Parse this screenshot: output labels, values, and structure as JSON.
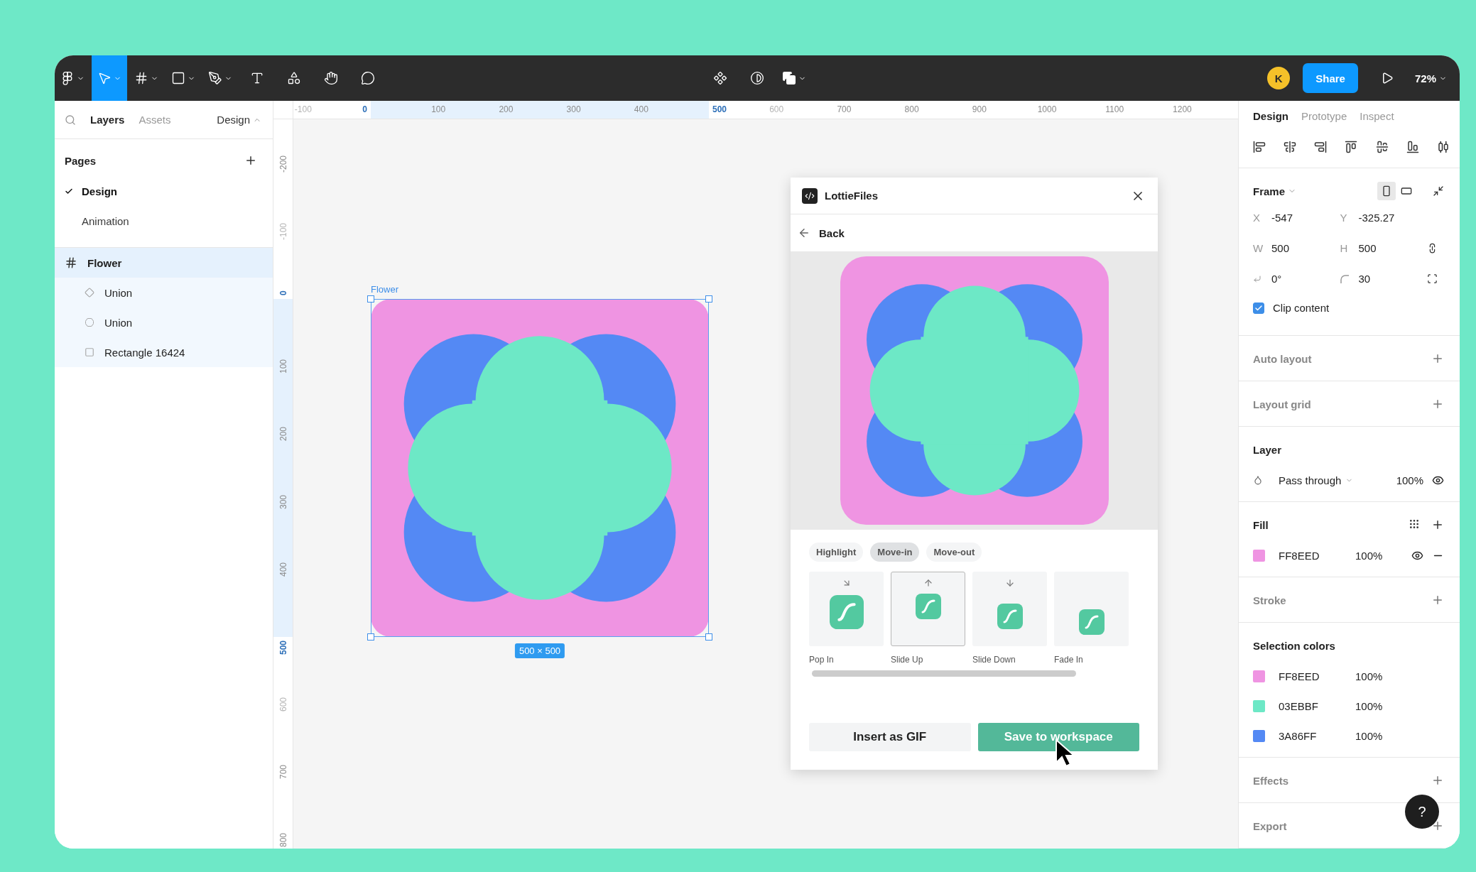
{
  "toolbar": {
    "tools": [
      {
        "kind": "logo",
        "selected": false,
        "caret": true
      },
      {
        "kind": "move",
        "selected": true,
        "caret": true
      },
      {
        "kind": "frame",
        "selected": false,
        "caret": true
      },
      {
        "kind": "rectangle",
        "selected": false,
        "caret": true
      },
      {
        "kind": "pen",
        "selected": false,
        "caret": true
      },
      {
        "kind": "text",
        "selected": false,
        "caret": false
      },
      {
        "kind": "components",
        "selected": false,
        "caret": false
      },
      {
        "kind": "hand",
        "selected": false,
        "caret": false
      },
      {
        "kind": "comment",
        "selected": false,
        "caret": false
      }
    ],
    "center_tools": [
      {
        "kind": "component",
        "caret": false
      },
      {
        "kind": "contrast",
        "caret": false
      },
      {
        "kind": "boolean",
        "caret": true
      }
    ],
    "avatar": "K",
    "share": "Share",
    "zoom": "72%"
  },
  "left_panel": {
    "tabs": [
      {
        "label": "Layers",
        "selected": true
      },
      {
        "label": "Assets",
        "selected": false
      }
    ],
    "page_menu": "Design",
    "pages_title": "Pages",
    "pages": [
      {
        "label": "Design",
        "selected": true
      },
      {
        "label": "Animation",
        "selected": false
      }
    ],
    "layers": [
      {
        "name": "Flower",
        "kind": "frame",
        "selected": true,
        "children": [
          {
            "name": "Union",
            "kind": "diamond",
            "selected": false
          },
          {
            "name": "Union",
            "kind": "clover",
            "selected": false
          },
          {
            "name": "Rectangle 16424",
            "kind": "rectangle",
            "selected": false
          }
        ]
      }
    ]
  },
  "rulers": {
    "horizontal": [
      {
        "label": "-100",
        "kind": "faded"
      },
      {
        "label": "0",
        "kind": "start"
      },
      {
        "label": "100",
        "kind": "normal"
      },
      {
        "label": "200",
        "kind": "normal"
      },
      {
        "label": "300",
        "kind": "normal"
      },
      {
        "label": "400",
        "kind": "normal"
      },
      {
        "label": "500",
        "kind": "end"
      },
      {
        "label": "600",
        "kind": "faded"
      },
      {
        "label": "700",
        "kind": "normal"
      },
      {
        "label": "800",
        "kind": "normal"
      },
      {
        "label": "900",
        "kind": "normal"
      },
      {
        "label": "1000",
        "kind": "normal"
      },
      {
        "label": "1100",
        "kind": "normal"
      },
      {
        "label": "1200",
        "kind": "normal"
      }
    ],
    "vertical": [
      {
        "label": "-200",
        "kind": "normal"
      },
      {
        "label": "-100",
        "kind": "faded"
      },
      {
        "label": "0",
        "kind": "start"
      },
      {
        "label": "100",
        "kind": "normal"
      },
      {
        "label": "200",
        "kind": "normal"
      },
      {
        "label": "300",
        "kind": "normal"
      },
      {
        "label": "400",
        "kind": "normal"
      },
      {
        "label": "500",
        "kind": "end"
      },
      {
        "label": "600",
        "kind": "faded"
      },
      {
        "label": "700",
        "kind": "normal"
      },
      {
        "label": "800",
        "kind": "normal"
      }
    ]
  },
  "canvas": {
    "frame_label": "Flower",
    "size_badge": "500 × 500"
  },
  "plugin": {
    "title": "LottieFiles",
    "back": "Back",
    "tabs": [
      {
        "label": "Highlight",
        "selected": false
      },
      {
        "label": "Move-in",
        "selected": true
      },
      {
        "label": "Move-out",
        "selected": false
      }
    ],
    "animations": [
      {
        "label": "Pop In",
        "kind": "pop",
        "selected": false
      },
      {
        "label": "Slide Up",
        "kind": "slide-up",
        "selected": true
      },
      {
        "label": "Slide Down",
        "kind": "slide-down",
        "selected": false
      },
      {
        "label": "Fade In",
        "kind": "fade",
        "selected": false
      }
    ],
    "buttons": [
      {
        "label": "Insert as GIF",
        "kind": "secondary"
      },
      {
        "label": "Save to workspace",
        "kind": "primary"
      }
    ]
  },
  "right_panel": {
    "tabs": [
      {
        "label": "Design",
        "selected": true
      },
      {
        "label": "Prototype",
        "selected": false
      },
      {
        "label": "Inspect",
        "selected": false
      }
    ],
    "frame": {
      "title": "Frame",
      "orientation": [
        {
          "kind": "portrait",
          "selected": true
        },
        {
          "kind": "landscape",
          "selected": false
        }
      ],
      "fields": [
        {
          "kind": "text",
          "label": "X",
          "value": "-547"
        },
        {
          "kind": "text",
          "label": "Y",
          "value": "-325.27"
        },
        {
          "kind": "text",
          "label": "W",
          "value": "500"
        },
        {
          "kind": "text",
          "label": "H",
          "value": "500"
        },
        {
          "kind": "rotation",
          "value": "0°"
        },
        {
          "kind": "radius",
          "value": "30"
        }
      ],
      "clip": {
        "label": "Clip content",
        "checked": true
      }
    },
    "sections": [
      {
        "kind": "add",
        "title": "Auto layout"
      },
      {
        "kind": "add",
        "title": "Layout grid"
      },
      {
        "kind": "layer",
        "title": "Layer",
        "blend": "Pass through",
        "opacity": "100%"
      },
      {
        "kind": "fill",
        "title": "Fill",
        "colors": [
          {
            "hex": "FF8EED",
            "opacity": "100%",
            "color": "#ef94e2"
          }
        ]
      },
      {
        "kind": "add",
        "title": "Stroke"
      },
      {
        "kind": "colors",
        "title": "Selection colors",
        "colors": [
          {
            "hex": "FF8EED",
            "opacity": "100%",
            "color": "#ef94e2"
          },
          {
            "hex": "03EBBF",
            "opacity": "100%",
            "color": "#6de8c6"
          },
          {
            "hex": "3A86FF",
            "opacity": "100%",
            "color": "#5489f4"
          }
        ]
      },
      {
        "kind": "add",
        "title": "Effects"
      },
      {
        "kind": "add",
        "title": "Export"
      }
    ]
  },
  "help": "?"
}
